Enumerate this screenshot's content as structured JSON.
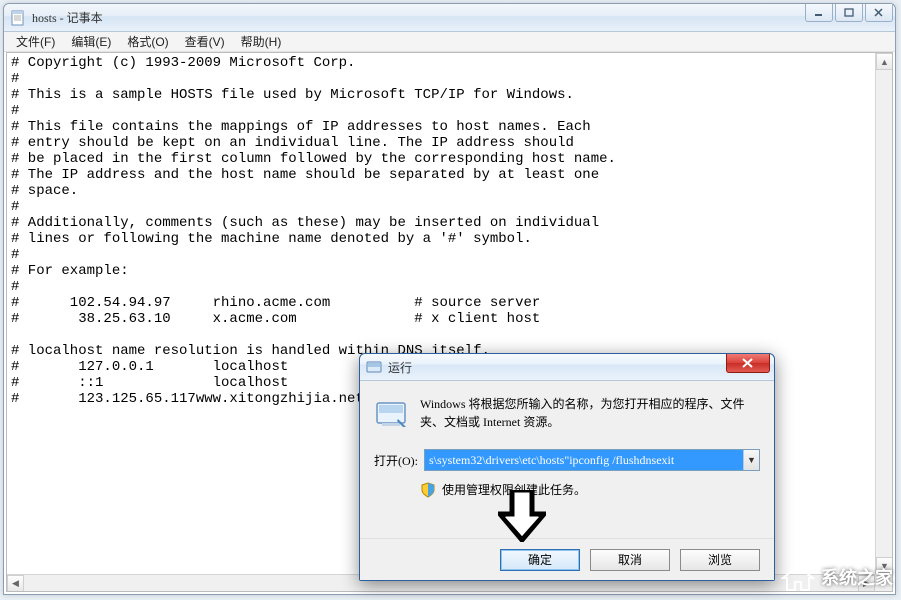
{
  "notepad": {
    "title": "hosts - 记事本",
    "menu": {
      "file": "文件(F)",
      "edit": "编辑(E)",
      "format": "格式(O)",
      "view": "查看(V)",
      "help": "帮助(H)"
    },
    "content": "# Copyright (c) 1993-2009 Microsoft Corp.\n#\n# This is a sample HOSTS file used by Microsoft TCP/IP for Windows.\n#\n# This file contains the mappings of IP addresses to host names. Each\n# entry should be kept on an individual line. The IP address should\n# be placed in the first column followed by the corresponding host name.\n# The IP address and the host name should be separated by at least one\n# space.\n#\n# Additionally, comments (such as these) may be inserted on individual\n# lines or following the machine name denoted by a '#' symbol.\n#\n# For example:\n#\n#      102.54.94.97     rhino.acme.com          # source server\n#       38.25.63.10     x.acme.com              # x client host\n\n# localhost name resolution is handled within DNS itself.\n#       127.0.0.1       localhost\n#       ::1             localhost\n#       123.125.65.117www.xitongzhijia.net"
  },
  "run": {
    "title": "运行",
    "description": "Windows 将根据您所输入的名称，为您打开相应的程序、文件夹、文档或 Internet 资源。",
    "open_label": "打开(O):",
    "input_value": "s\\system32\\drivers\\etc\\hosts\"ipconfig /flushdnsexit",
    "admin_note": "使用管理权限创建此任务。",
    "buttons": {
      "ok": "确定",
      "cancel": "取消",
      "browse": "浏览"
    }
  },
  "watermark": {
    "text": "系统之家"
  }
}
